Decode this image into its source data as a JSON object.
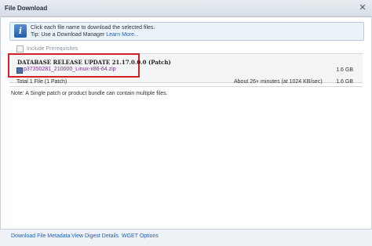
{
  "window": {
    "title": "File Download",
    "close_glyph": "✕"
  },
  "info": {
    "icon": "i",
    "line1": "Click each file name to download the selected files.",
    "line2_prefix": "Tip: Use a Download Manager",
    "line2_link": "Learn More..."
  },
  "prerequisites": {
    "label": "Include Prerequisites",
    "checked": false
  },
  "patch": {
    "title": "DATABASE RELEASE UPDATE 21.17.0.0.0 (Patch)",
    "file_name": "p37350281_210000_Linux-x86-64.zip",
    "file_size": "1.6 GB"
  },
  "total": {
    "label": "Total 1 File (1 Patch)",
    "time": "About 26+ minutes (at 1024 KB/sec)",
    "size": "1.6 GB"
  },
  "note": "Note: A Single patch or product bundle can contain multiple files.",
  "footer": {
    "link1": "Download File Metadata",
    "link2": "View Digest Details",
    "link3": "WGET Options"
  },
  "colors": {
    "highlight": "#d0202a",
    "link": "#1e62b7",
    "visited_link": "#7b2c96"
  }
}
